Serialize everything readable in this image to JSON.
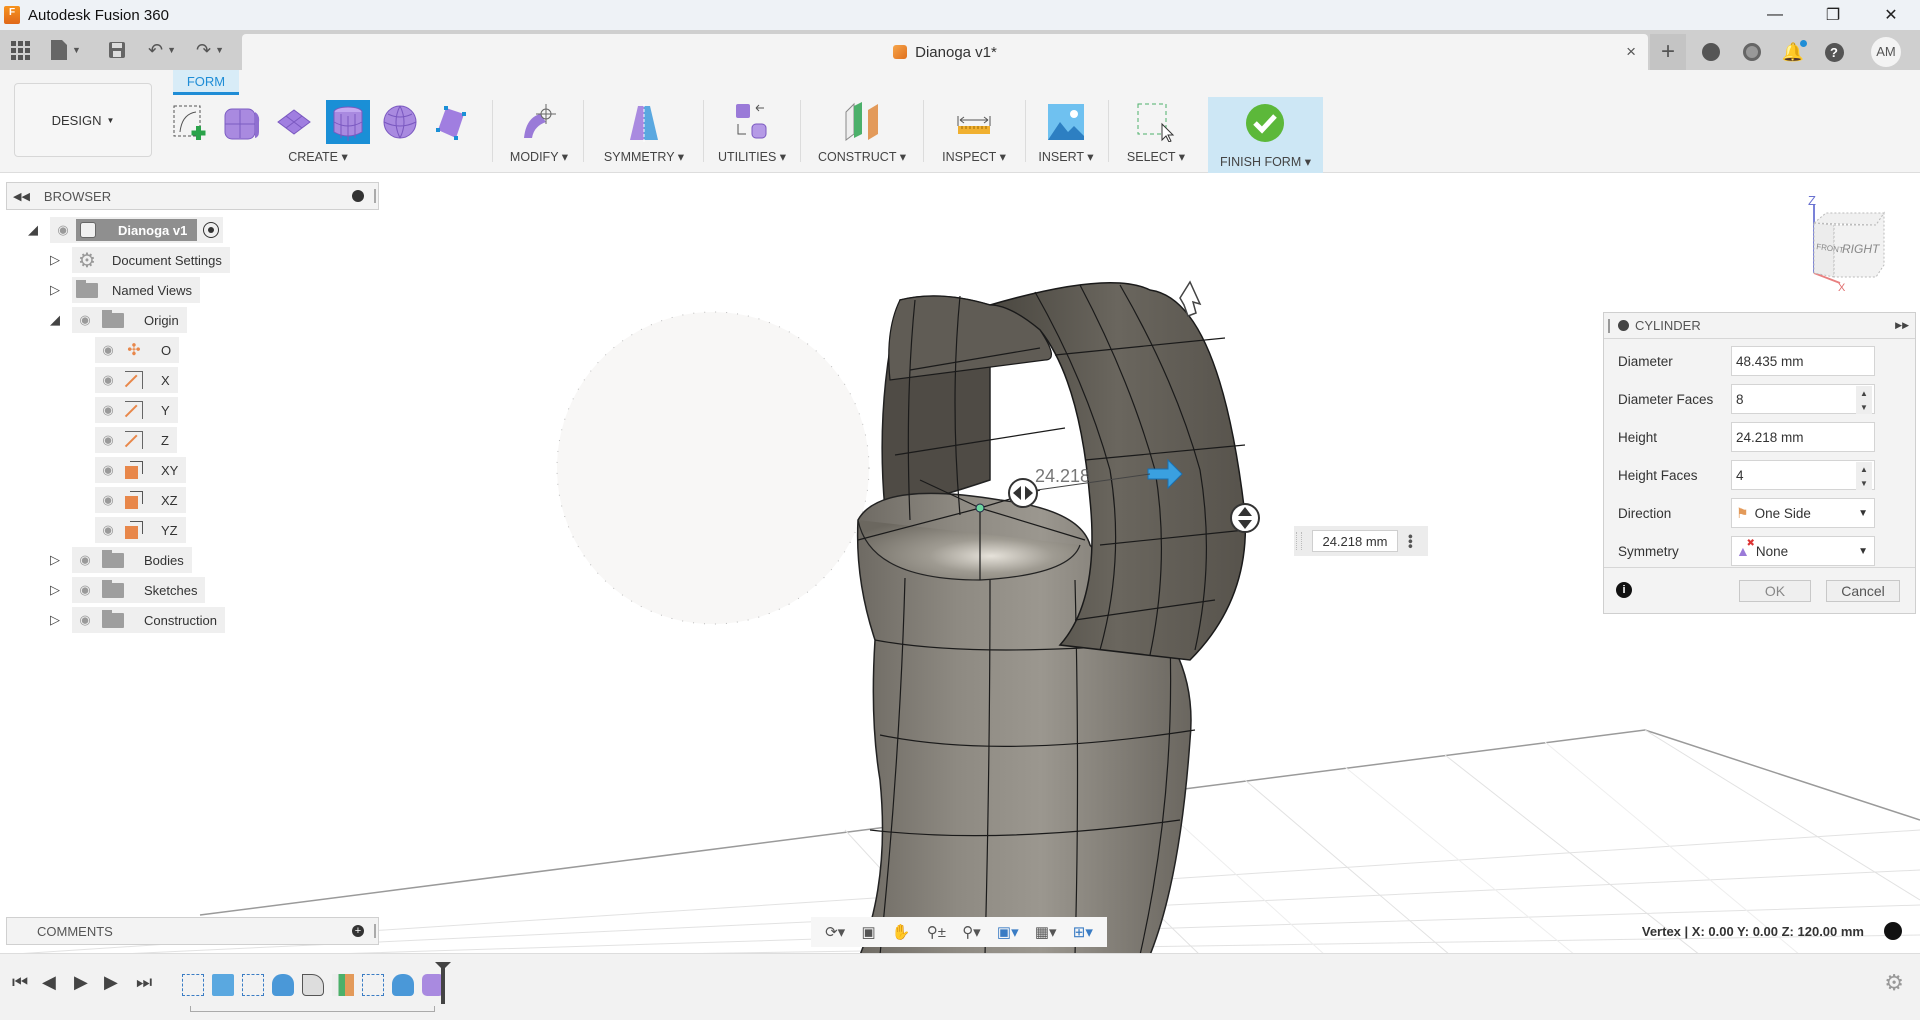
{
  "window": {
    "title": "Autodesk Fusion 360",
    "controls": [
      "minimize",
      "restore",
      "close"
    ]
  },
  "quick_access": {
    "icons": [
      "data-panel-icon",
      "file-menu-icon",
      "save-icon",
      "undo-icon",
      "redo-icon"
    ]
  },
  "document_tab": {
    "name": "Dianoga v1*",
    "close": "×"
  },
  "header_right": {
    "icons": [
      "new-tab-icon",
      "extensions-icon",
      "job-status-icon",
      "notifications-icon",
      "help-icon"
    ],
    "user_initials": "AM"
  },
  "toolbar": {
    "workspace": "DESIGN",
    "active_tab": "FORM",
    "groups": [
      {
        "label": "CREATE",
        "tools": [
          "create-sketch",
          "box",
          "plane",
          "cylinder",
          "sphere",
          "face"
        ],
        "active_tool": "cylinder"
      },
      {
        "label": "MODIFY"
      },
      {
        "label": "SYMMETRY"
      },
      {
        "label": "UTILITIES"
      },
      {
        "label": "CONSTRUCT"
      },
      {
        "label": "INSPECT"
      },
      {
        "label": "INSERT"
      },
      {
        "label": "SELECT"
      },
      {
        "label": "FINISH FORM"
      }
    ]
  },
  "browser": {
    "title": "BROWSER",
    "items": [
      {
        "label": "Dianoga v1",
        "level": 0,
        "expanded": true,
        "type": "component"
      },
      {
        "label": "Document Settings",
        "level": 1,
        "expanded": false,
        "type": "settings"
      },
      {
        "label": "Named Views",
        "level": 1,
        "expanded": false,
        "type": "folder"
      },
      {
        "label": "Origin",
        "level": 1,
        "expanded": true,
        "type": "folder"
      },
      {
        "label": "O",
        "level": 2,
        "type": "point"
      },
      {
        "label": "X",
        "level": 2,
        "type": "axis"
      },
      {
        "label": "Y",
        "level": 2,
        "type": "axis"
      },
      {
        "label": "Z",
        "level": 2,
        "type": "axis"
      },
      {
        "label": "XY",
        "level": 2,
        "type": "plane"
      },
      {
        "label": "XZ",
        "level": 2,
        "type": "plane"
      },
      {
        "label": "YZ",
        "level": 2,
        "type": "plane"
      },
      {
        "label": "Bodies",
        "level": 1,
        "expanded": false,
        "type": "folder"
      },
      {
        "label": "Sketches",
        "level": 1,
        "expanded": false,
        "type": "folder"
      },
      {
        "label": "Construction",
        "level": 1,
        "expanded": false,
        "type": "folder"
      }
    ]
  },
  "comments": {
    "title": "COMMENTS"
  },
  "viewcube": {
    "face_right": "RIGHT",
    "face_front": "FRONT",
    "axis_z": "Z",
    "axis_x": "X"
  },
  "cylinder_panel": {
    "title": "CYLINDER",
    "fields": {
      "diameter": {
        "label": "Diameter",
        "value": "48.435 mm"
      },
      "diameter_faces": {
        "label": "Diameter Faces",
        "value": "8"
      },
      "height": {
        "label": "Height",
        "value": "24.218 mm"
      },
      "height_faces": {
        "label": "Height Faces",
        "value": "4"
      },
      "direction": {
        "label": "Direction",
        "value": "One Side"
      },
      "symmetry": {
        "label": "Symmetry",
        "value": "None"
      }
    },
    "ok": "OK",
    "cancel": "Cancel"
  },
  "viewport": {
    "dimension_label": "24.218",
    "dimension_input": "24.218 mm"
  },
  "status": {
    "text": "Vertex | X: 0.00 Y: 0.00 Z: 120.00 mm"
  },
  "navbar": {
    "icons": [
      "orbit-icon",
      "look-at-icon",
      "pan-icon",
      "zoom-icon",
      "fit-icon",
      "display-settings-icon",
      "grid-icon",
      "viewports-icon"
    ]
  },
  "timeline": {
    "controls": [
      "go-to-start",
      "step-back",
      "play",
      "step-forward",
      "go-to-end"
    ],
    "features": [
      "sketch",
      "extrude",
      "sketch",
      "form",
      "fillet",
      "plane",
      "sketch",
      "form",
      "form-body"
    ]
  }
}
